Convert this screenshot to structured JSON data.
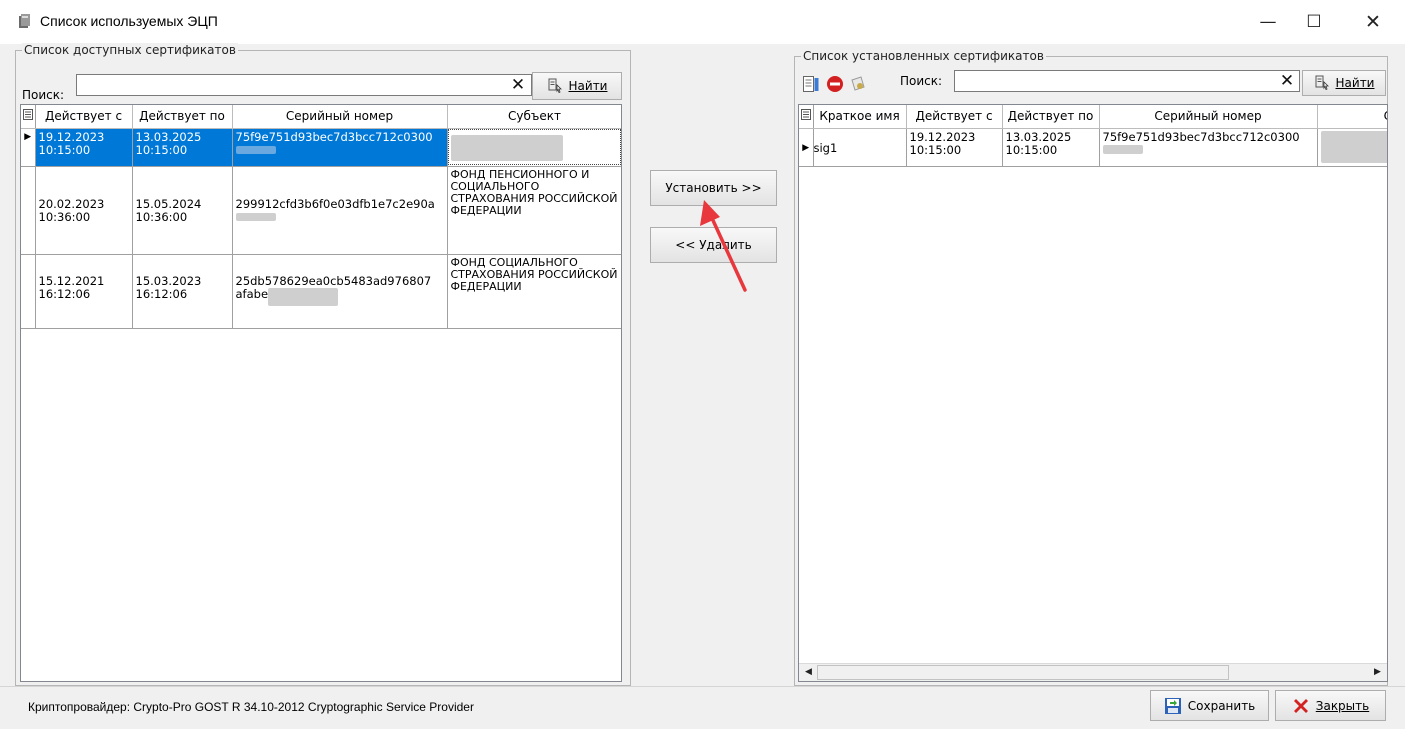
{
  "window": {
    "title": "Список используемых ЭЦП",
    "minimize": "—",
    "maximize": "☐",
    "close": "✕"
  },
  "available": {
    "group_title": "Список доступных сертификатов",
    "search_label": "Поиск:",
    "search_value": "",
    "clear_label": "✕",
    "find_prefix": "",
    "find_label": "Найти",
    "columns": [
      "Действует с",
      "Действует по",
      "Серийный номер",
      "Субъект"
    ],
    "rows": [
      {
        "from_date": "19.12.2023",
        "from_time": "10:15:00",
        "to_date": "13.03.2025",
        "to_time": "10:15:00",
        "serial": "75f9e751d93bec7d3bcc712c0300",
        "subject": ""
      },
      {
        "from_date": "20.02.2023",
        "from_time": "10:36:00",
        "to_date": "15.05.2024",
        "to_time": "10:36:00",
        "serial": "299912cfd3b6f0e03dfb1e7c2e90a",
        "subject": "ФОНД ПЕНСИОННОГО И СОЦИАЛЬНОГО СТРАХОВАНИЯ РОССИЙСКОЙ ФЕДЕРАЦИИ"
      },
      {
        "from_date": "15.12.2021",
        "from_time": "16:12:06",
        "to_date": "15.03.2023",
        "to_time": "16:12:06",
        "serial": "25db578629ea0cb5483ad976807",
        "serial2": "afabe",
        "subject": "ФОНД СОЦИАЛЬНОГО СТРАХОВАНИЯ РОССИЙСКОЙ ФЕДЕРАЦИИ"
      }
    ]
  },
  "middle": {
    "install_label": "Установить >>",
    "remove_label": "<< Удалить"
  },
  "installed": {
    "group_title": "Список установленных сертификатов",
    "search_label": "Поиск:",
    "search_value": "",
    "clear_label": "✕",
    "find_label": "Найти",
    "columns": [
      "Краткое имя",
      "Действует с",
      "Действует по",
      "Серийный номер",
      "Суб"
    ],
    "rows": [
      {
        "name": "sig1",
        "from_date": "19.12.2023",
        "from_time": "10:15:00",
        "to_date": "13.03.2025",
        "to_time": "10:15:00",
        "serial": "75f9e751d93bec7d3bcc712c0300"
      }
    ]
  },
  "status": {
    "provider": "Криптопровайдер: Crypto-Pro GOST R 34.10-2012 Cryptographic Service Provider"
  },
  "footer": {
    "save_label": "Сохранить",
    "close_label": "Закрыть"
  },
  "colors": {
    "selection": "#0078d7",
    "annotation_arrow": "#e8383d"
  }
}
